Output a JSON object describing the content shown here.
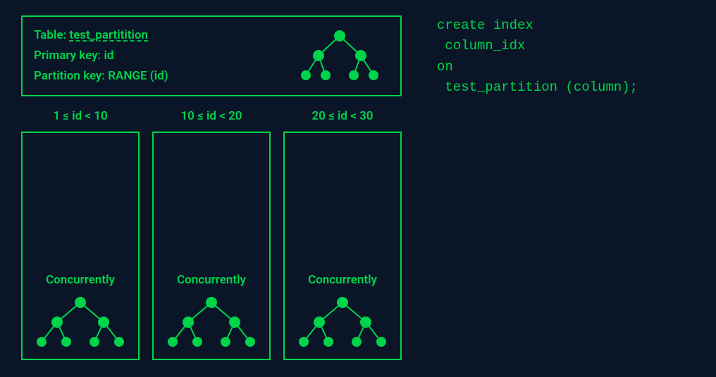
{
  "header": {
    "table_label": "Table:",
    "table_name": "test_partitition",
    "pk_label": "Primary key:",
    "pk_value": "id",
    "partkey_label": "Partition key:",
    "partkey_value": "RANGE (id)"
  },
  "partitions": [
    {
      "range": "1 ≤ id < 10",
      "status": "Concurrently"
    },
    {
      "range": "10 ≤ id < 20",
      "status": "Concurrently"
    },
    {
      "range": "20 ≤ id < 30",
      "status": "Concurrently"
    }
  ],
  "code": {
    "line1": "create index",
    "line2": " column_idx",
    "line3": "on",
    "line4": " test_partition (column);"
  },
  "colors": {
    "bg": "#0a1628",
    "accent": "#00d44a"
  },
  "tree": {
    "node_radius_large": 8,
    "node_radius_small": 7,
    "stroke": "#00d44a",
    "fill": "#00d44a"
  }
}
